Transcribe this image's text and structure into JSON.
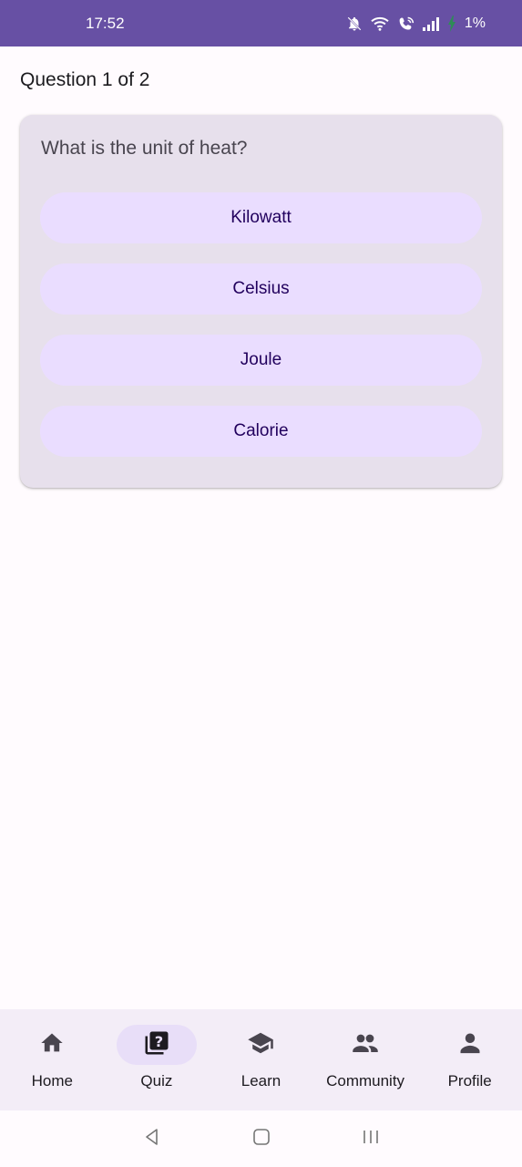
{
  "status_bar": {
    "time": "17:52",
    "battery": "1%",
    "icons": [
      "bell-off-icon",
      "wifi-icon",
      "wifi-call-icon",
      "signal-icon",
      "battery-charging-icon"
    ]
  },
  "quiz": {
    "counter": "Question 1 of 2",
    "question": "What is the unit of heat?",
    "answers": [
      "Kilowatt",
      "Celsius",
      "Joule",
      "Calorie"
    ]
  },
  "bottom_nav": {
    "items": [
      {
        "label": "Home",
        "icon": "home-icon"
      },
      {
        "label": "Quiz",
        "icon": "quiz-icon",
        "active": true
      },
      {
        "label": "Learn",
        "icon": "graduation-cap-icon"
      },
      {
        "label": "Community",
        "icon": "people-icon"
      },
      {
        "label": "Profile",
        "icon": "person-icon"
      }
    ]
  },
  "system_nav": {
    "icons": [
      "back-icon",
      "home-square-icon",
      "recents-icon"
    ]
  },
  "colors": {
    "status_bar": "#6750a4",
    "background": "#fffbfe",
    "card": "#e7e0ec",
    "answer_button": "#eaddff",
    "answer_text": "#21005d",
    "nav_background": "#f3edf7",
    "nav_active_pill": "#e8def8"
  }
}
